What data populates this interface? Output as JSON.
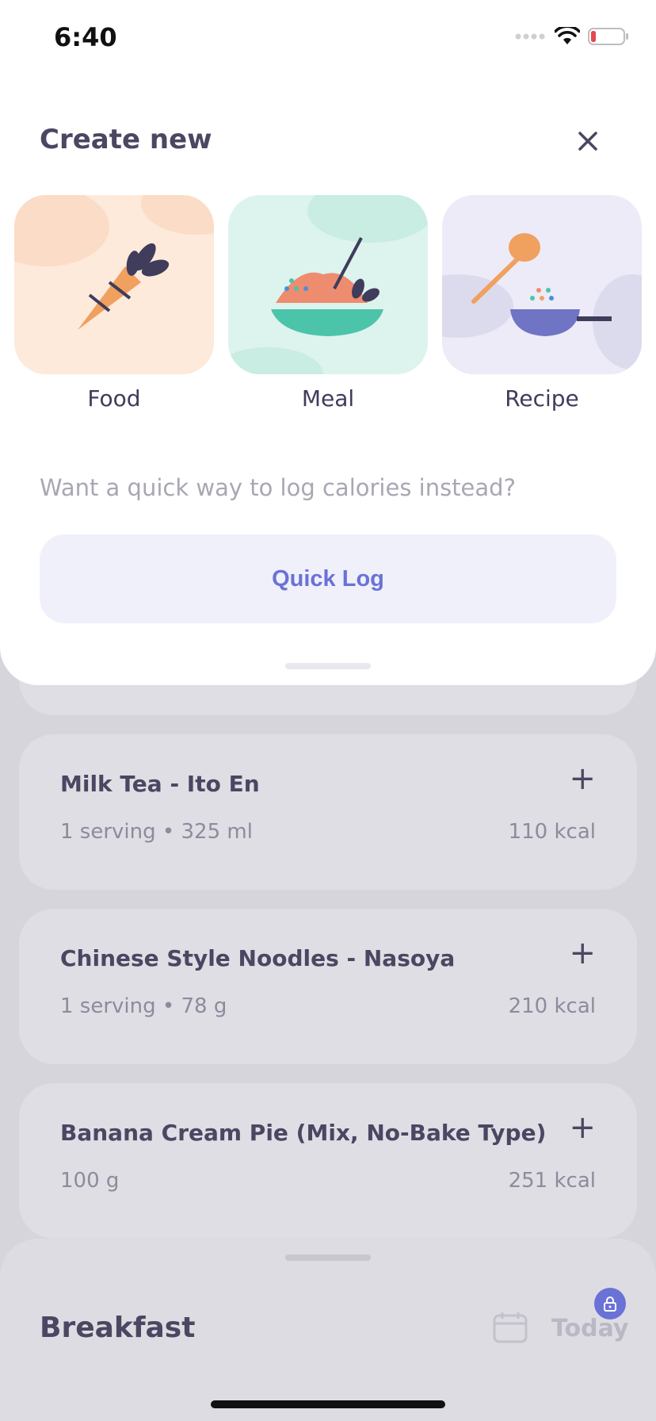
{
  "status_bar": {
    "time": "6:40"
  },
  "sheet": {
    "title": "Create new",
    "tiles": [
      {
        "label": "Food"
      },
      {
        "label": "Meal"
      },
      {
        "label": "Recipe"
      }
    ],
    "hint": "Want a quick way to log calories instead?",
    "quick_log_label": "Quick Log"
  },
  "list": {
    "items": [
      {
        "name": "Milk Tea - Ito En",
        "serving": "1 serving • 325 ml",
        "kcal": "110 kcal"
      },
      {
        "name": "Chinese Style Noodles - Nasoya",
        "serving": "1 serving • 78 g",
        "kcal": "210 kcal"
      },
      {
        "name": "Banana Cream Pie (Mix, No-Bake Type)",
        "serving": "100 g",
        "kcal": "251 kcal"
      }
    ],
    "add_symbol": "+"
  },
  "bottom_panel": {
    "meal": "Breakfast",
    "date_label": "Today"
  },
  "colors": {
    "accent": "#6a72d6",
    "text_dark": "#3f3c5c",
    "food_tile": "#fdeadb",
    "meal_tile": "#ddf3ee",
    "recipe_tile": "#ecebf7"
  }
}
